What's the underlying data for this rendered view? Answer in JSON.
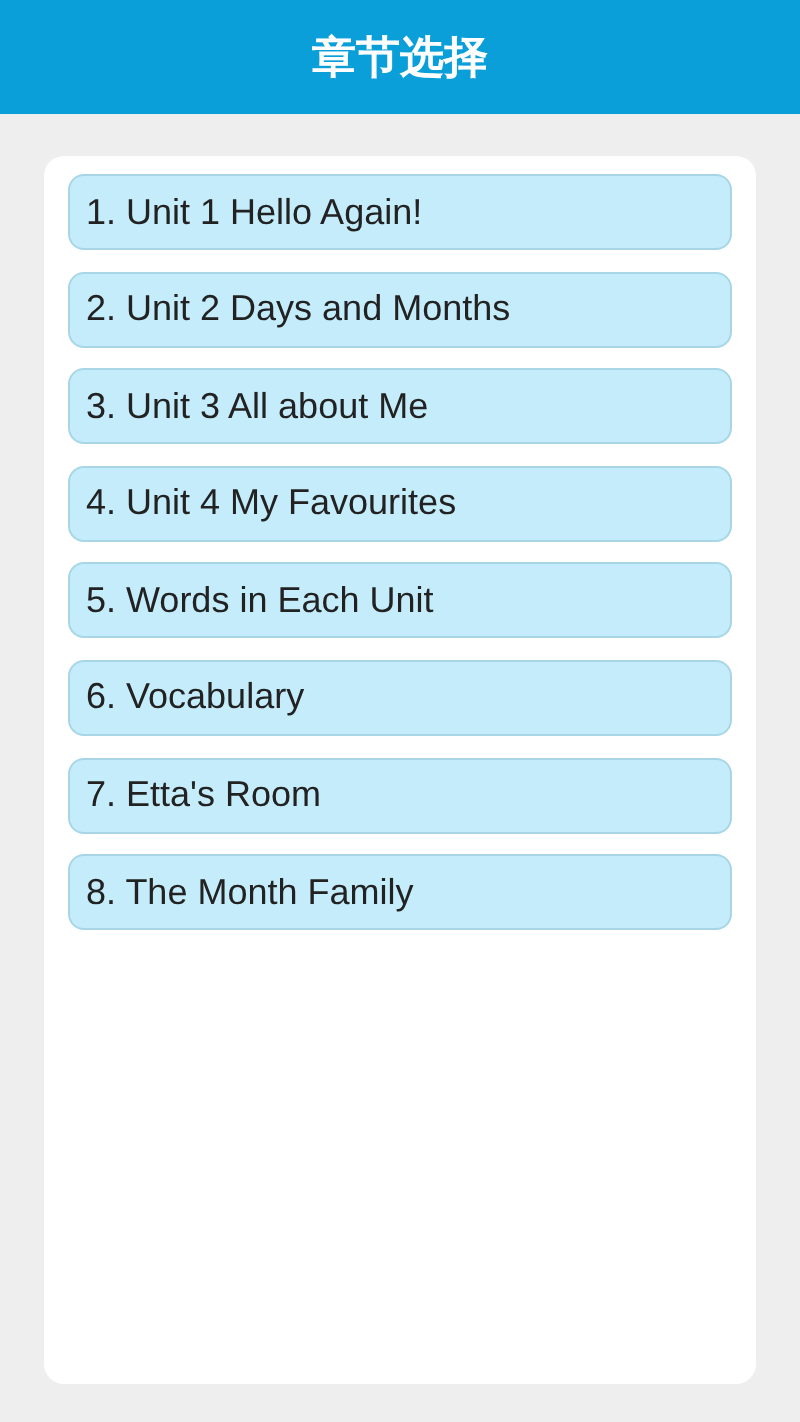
{
  "header": {
    "title": "章节选择"
  },
  "chapters": [
    {
      "label": "1. Unit 1 Hello Again!"
    },
    {
      "label": "2. Unit 2 Days and Months"
    },
    {
      "label": "3. Unit 3 All about Me"
    },
    {
      "label": "4. Unit 4 My Favourites"
    },
    {
      "label": "5. Words in Each Unit"
    },
    {
      "label": "6. Vocabulary"
    },
    {
      "label": "7. Etta's Room"
    },
    {
      "label": "8. The Month Family"
    }
  ]
}
